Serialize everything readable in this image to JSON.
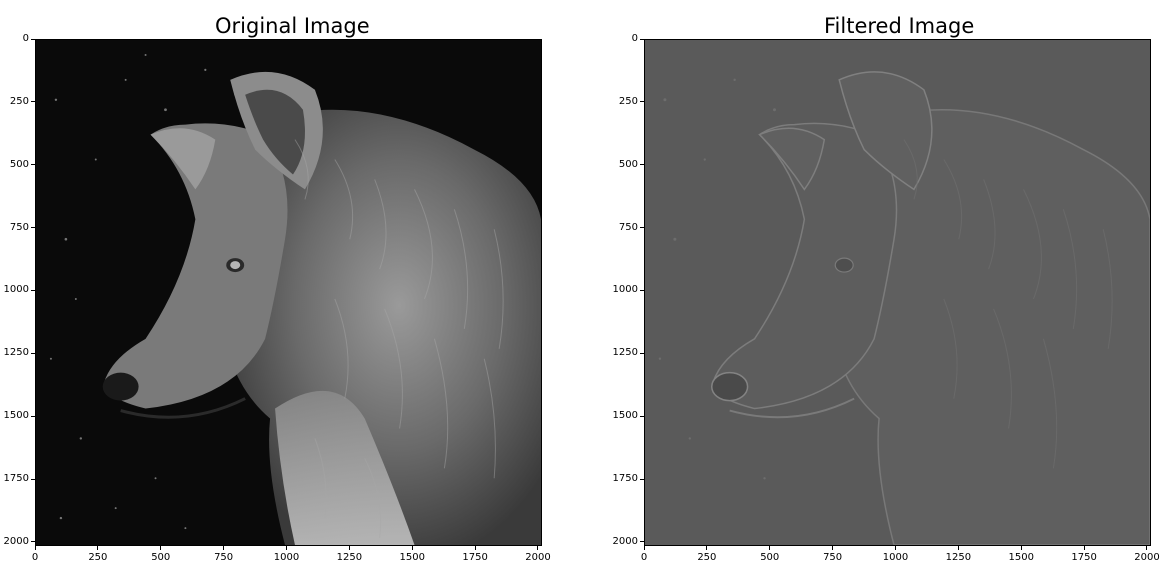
{
  "figure": {
    "panels": [
      {
        "id": "original",
        "title": "Original Image",
        "image_subject": "wolf-profile-grayscale",
        "background": "#0a0a0a",
        "x_ticks": [
          "0",
          "250",
          "500",
          "750",
          "1000",
          "1250",
          "1500",
          "1750",
          "2000"
        ],
        "y_ticks": [
          "0",
          "250",
          "500",
          "750",
          "1000",
          "1250",
          "1500",
          "1750",
          "2000"
        ]
      },
      {
        "id": "filtered",
        "title": "Filtered Image",
        "image_subject": "wolf-profile-edge-filtered",
        "background": "#5a5a5a",
        "x_ticks": [
          "0",
          "250",
          "500",
          "750",
          "1000",
          "1250",
          "1500",
          "1750",
          "2000"
        ],
        "y_ticks": [
          "0",
          "250",
          "500",
          "750",
          "1000",
          "1250",
          "1500",
          "1750",
          "2000"
        ]
      }
    ],
    "axis_range": [
      0,
      2016
    ],
    "grid": false
  }
}
